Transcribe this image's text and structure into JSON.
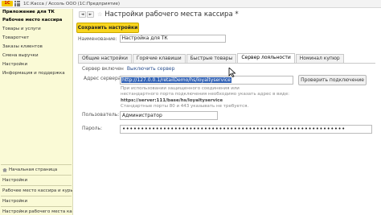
{
  "window": {
    "title": "1С:Касса / Ассоль ООО  (1С:Предприятие)",
    "logo_text": "1С"
  },
  "sidebar": {
    "header": "Приложение для ТК",
    "items": [
      {
        "label": "Рабочее место кассира"
      },
      {
        "label": "Товары и услуги"
      },
      {
        "label": "Товаротчет"
      },
      {
        "label": "Заказы клиентов"
      },
      {
        "label": "Смена выручки"
      },
      {
        "label": "Настройки"
      },
      {
        "label": "Информация и поддержка"
      }
    ],
    "bottom_links": [
      {
        "label": "Начальная страница"
      },
      {
        "label": "Настройки"
      },
      {
        "label": "Рабочее место кассира и курьеров"
      },
      {
        "label": "Настройки"
      },
      {
        "label": "Настройки рабочего места кассира *"
      }
    ]
  },
  "header": {
    "back": "◄",
    "forward": "►",
    "star": "☆",
    "title": "Настройки рабочего места кассира *"
  },
  "toolbar": {
    "save_label": "Сохранить настройки"
  },
  "form": {
    "name_label": "Наименование:",
    "name_value": "Настройка для ТК",
    "tabs": [
      {
        "label": "Общие настройки"
      },
      {
        "label": "Горячие клавиши"
      },
      {
        "label": "Быстрые товары"
      },
      {
        "label": "Сервер лояльности"
      },
      {
        "label": "Номинал купюр"
      }
    ],
    "active_tab": "Сервер лояльности",
    "server_status": "Сервер включен",
    "disable_link": "Выключить сервер",
    "address_label": "Адрес сервера:",
    "address_value": "http://127.0.0.1/retailDemo/hs/loyaltyservice",
    "check_button": "Проверить подключение",
    "hint_1": "При использовании защищенного соединения или",
    "hint_2": "нестандартного порта подключения необходимо указать адрес в виде:",
    "hint_3": "https://server:111/base/hs/loyaltyservice",
    "hint_4": "Стандартные порты 80 и 443 указывать не требуется.",
    "user_label": "Пользователь:",
    "user_value": "Администратор",
    "password_label": "Пароль:",
    "password_value": "••••••••••••••••••••••••••••••••••••••••••••••••••••••••••••"
  }
}
